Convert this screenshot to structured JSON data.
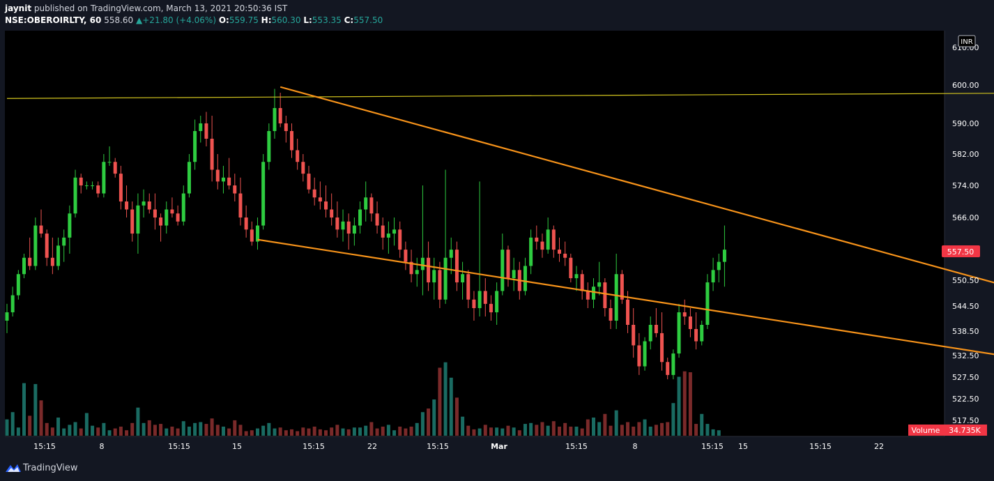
{
  "header": {
    "author": "jaynit",
    "published_text": "published on TradingView.com, March 13, 2021 20:50:36 IST",
    "symbol": "NSE:OBEROIRLTY, 60",
    "last": "558.60",
    "change_arrow": "▲",
    "change": "+21.80 (+4.06%)",
    "o_label": "O:",
    "o_value": "559.75",
    "h_label": "H:",
    "h_value": "560.30",
    "l_label": "L:",
    "l_value": "553.35",
    "c_label": "C:",
    "c_value": "557.50"
  },
  "footer": {
    "brand": "TradingView"
  },
  "colors": {
    "background": "#000000",
    "up": "#26a69a",
    "candle_up": "#2ecc40",
    "candle_down": "#ef5350",
    "vol_up": "#1a6b62",
    "vol_down": "#7a2a2a",
    "channel": "#f7931a",
    "resistance": "#d4c61e",
    "price_badge": "#f23645"
  },
  "chart_data": {
    "type": "candlestick",
    "interval": "60",
    "currency": "INR",
    "y_ticks": [
      "610.00",
      "600.00",
      "590.00",
      "582.00",
      "574.00",
      "566.00",
      "557.50",
      "550.50",
      "544.50",
      "538.50",
      "532.50",
      "527.50",
      "522.50",
      "517.50"
    ],
    "x_ticks": [
      "15:15",
      "8",
      "15:15",
      "15",
      "15:15",
      "22",
      "15:15",
      "Mar",
      "15:15",
      "8",
      "15:15",
      "15",
      "15:15",
      "22"
    ],
    "last_price_label": "557.50",
    "volume_label": "Volume",
    "volume_value": "34.735K",
    "lines": [
      {
        "name": "resistance",
        "points": [
          [
            0,
            596.5
          ],
          [
            243,
            598.4
          ]
        ]
      },
      {
        "name": "channel-upper",
        "points": [
          [
            48,
            599.5
          ],
          [
            207,
            537.5
          ]
        ]
      },
      {
        "name": "channel-lower",
        "points": [
          [
            44,
            560.5
          ],
          [
            260,
            515
          ]
        ]
      }
    ],
    "candles": [
      [
        541,
        545,
        538,
        543
      ],
      [
        543,
        549,
        542,
        547
      ],
      [
        547,
        553,
        546,
        552
      ],
      [
        552,
        557,
        551,
        556
      ],
      [
        556,
        561,
        553,
        554
      ],
      [
        554,
        566,
        553,
        564
      ],
      [
        564,
        568,
        561,
        562
      ],
      [
        562,
        563,
        554,
        556
      ],
      [
        556,
        561,
        552,
        554
      ],
      [
        554,
        561,
        553,
        559
      ],
      [
        559,
        563,
        555,
        561
      ],
      [
        561,
        569,
        557,
        567
      ],
      [
        567,
        578,
        566,
        576
      ],
      [
        576,
        577,
        572,
        574
      ],
      [
        574,
        575,
        573,
        574
      ],
      [
        574,
        575,
        573,
        574
      ],
      [
        574,
        575,
        571,
        572
      ],
      [
        572,
        582,
        571,
        580
      ],
      [
        580,
        584,
        579,
        580
      ],
      [
        580,
        581,
        576,
        577
      ],
      [
        577,
        579,
        568,
        570
      ],
      [
        570,
        574,
        566,
        568
      ],
      [
        568,
        570,
        560,
        562
      ],
      [
        562,
        572,
        557,
        569
      ],
      [
        569,
        573,
        566,
        570
      ],
      [
        570,
        572,
        567,
        568
      ],
      [
        568,
        572,
        563,
        566
      ],
      [
        566,
        567,
        560,
        564
      ],
      [
        564,
        570,
        562,
        568
      ],
      [
        568,
        571,
        566,
        567
      ],
      [
        567,
        569,
        564,
        565
      ],
      [
        565,
        574,
        564,
        572
      ],
      [
        572,
        582,
        571,
        580
      ],
      [
        580,
        591,
        578,
        588
      ],
      [
        588,
        592,
        585,
        590
      ],
      [
        590,
        593,
        584,
        586
      ],
      [
        586,
        592,
        575,
        578
      ],
      [
        578,
        582,
        573,
        575
      ],
      [
        575,
        579,
        572,
        576
      ],
      [
        576,
        581,
        573,
        574
      ],
      [
        574,
        577,
        570,
        572
      ],
      [
        572,
        576,
        564,
        566
      ],
      [
        566,
        569,
        561,
        563
      ],
      [
        563,
        565,
        559,
        560
      ],
      [
        560,
        566,
        558,
        564
      ],
      [
        564,
        582,
        563,
        580
      ],
      [
        580,
        590,
        578,
        588
      ],
      [
        588,
        599,
        586,
        594
      ],
      [
        594,
        598,
        589,
        590
      ],
      [
        590,
        592,
        585,
        588
      ],
      [
        588,
        590,
        581,
        583
      ],
      [
        583,
        586,
        578,
        580
      ],
      [
        580,
        582,
        575,
        577
      ],
      [
        577,
        579,
        572,
        573
      ],
      [
        573,
        576,
        569,
        571
      ],
      [
        571,
        575,
        568,
        570
      ],
      [
        570,
        574,
        566,
        568
      ],
      [
        568,
        572,
        564,
        566
      ],
      [
        566,
        570,
        561,
        563
      ],
      [
        563,
        568,
        560,
        565
      ],
      [
        565,
        567,
        558,
        562
      ],
      [
        562,
        566,
        559,
        564
      ],
      [
        564,
        570,
        562,
        568
      ],
      [
        568,
        575,
        565,
        571
      ],
      [
        571,
        572,
        565,
        567
      ],
      [
        567,
        570,
        562,
        564
      ],
      [
        564,
        566,
        558,
        561
      ],
      [
        561,
        565,
        557,
        562
      ],
      [
        562,
        566,
        559,
        563
      ],
      [
        563,
        565,
        556,
        558
      ],
      [
        558,
        560,
        553,
        555
      ],
      [
        555,
        558,
        550,
        552
      ],
      [
        552,
        556,
        549,
        553
      ],
      [
        553,
        574,
        547,
        556
      ],
      [
        556,
        560,
        548,
        550
      ],
      [
        550,
        556,
        546,
        553
      ],
      [
        553,
        555,
        544,
        546
      ],
      [
        546,
        578,
        545,
        556
      ],
      [
        556,
        561,
        552,
        558
      ],
      [
        558,
        560,
        548,
        550
      ],
      [
        550,
        555,
        546,
        552
      ],
      [
        552,
        553,
        544,
        546
      ],
      [
        546,
        548,
        541,
        544
      ],
      [
        544,
        575,
        542,
        548
      ],
      [
        548,
        551,
        542,
        545
      ],
      [
        545,
        547,
        541,
        543
      ],
      [
        543,
        550,
        540,
        548
      ],
      [
        548,
        562,
        547,
        558
      ],
      [
        558,
        559,
        549,
        551
      ],
      [
        551,
        556,
        548,
        553
      ],
      [
        553,
        555,
        546,
        548
      ],
      [
        548,
        556,
        547,
        554
      ],
      [
        554,
        563,
        552,
        561
      ],
      [
        561,
        564,
        558,
        560
      ],
      [
        560,
        562,
        556,
        558
      ],
      [
        558,
        566,
        557,
        563
      ],
      [
        563,
        564,
        556,
        558
      ],
      [
        558,
        561,
        555,
        557
      ],
      [
        557,
        560,
        554,
        556
      ],
      [
        556,
        557,
        550,
        551
      ],
      [
        551,
        554,
        548,
        552
      ],
      [
        552,
        553,
        546,
        548
      ],
      [
        548,
        550,
        544,
        546
      ],
      [
        546,
        551,
        544,
        549
      ],
      [
        549,
        555,
        547,
        550
      ],
      [
        550,
        551,
        542,
        544
      ],
      [
        544,
        546,
        539,
        541
      ],
      [
        541,
        557,
        539,
        552
      ],
      [
        552,
        553,
        545,
        546
      ],
      [
        546,
        548,
        538,
        540
      ],
      [
        540,
        544,
        532,
        535
      ],
      [
        535,
        538,
        528,
        530
      ],
      [
        530,
        537,
        529,
        536
      ],
      [
        536,
        542,
        534,
        540
      ],
      [
        540,
        544,
        537,
        538
      ],
      [
        538,
        543,
        529,
        531
      ],
      [
        531,
        532,
        527,
        528
      ],
      [
        528,
        534,
        527,
        533
      ],
      [
        533,
        545,
        532,
        543
      ],
      [
        543,
        546,
        540,
        542
      ],
      [
        542,
        544,
        537,
        539
      ],
      [
        539,
        543,
        534,
        536
      ],
      [
        536,
        541,
        535,
        540
      ],
      [
        540,
        552,
        539,
        550
      ],
      [
        550,
        556,
        548,
        553
      ],
      [
        553,
        557,
        550,
        555
      ],
      [
        555,
        564,
        549,
        558
      ]
    ],
    "volumes": [
      18,
      26,
      9,
      58,
      22,
      57,
      39,
      14,
      9,
      20,
      8,
      12,
      15,
      8,
      25,
      11,
      9,
      14,
      6,
      8,
      10,
      6,
      14,
      31,
      14,
      17,
      12,
      13,
      8,
      10,
      8,
      16,
      10,
      14,
      15,
      13,
      19,
      12,
      10,
      8,
      17,
      12,
      5,
      6,
      8,
      11,
      14,
      8,
      9,
      6,
      7,
      5,
      9,
      8,
      10,
      7,
      6,
      9,
      12,
      8,
      7,
      9,
      9,
      11,
      15,
      8,
      10,
      12,
      6,
      10,
      8,
      10,
      14,
      26,
      30,
      40,
      75,
      81,
      64,
      42,
      21,
      11,
      7,
      8,
      12,
      9,
      9,
      8,
      11,
      9,
      6,
      13,
      14,
      12,
      15,
      11,
      16,
      10,
      14,
      10,
      10,
      8,
      18,
      20,
      15,
      24,
      11,
      28,
      12,
      15,
      10,
      15,
      18,
      10,
      12,
      14,
      15,
      36,
      65,
      71,
      70,
      13,
      24,
      13,
      7,
      6
    ]
  }
}
